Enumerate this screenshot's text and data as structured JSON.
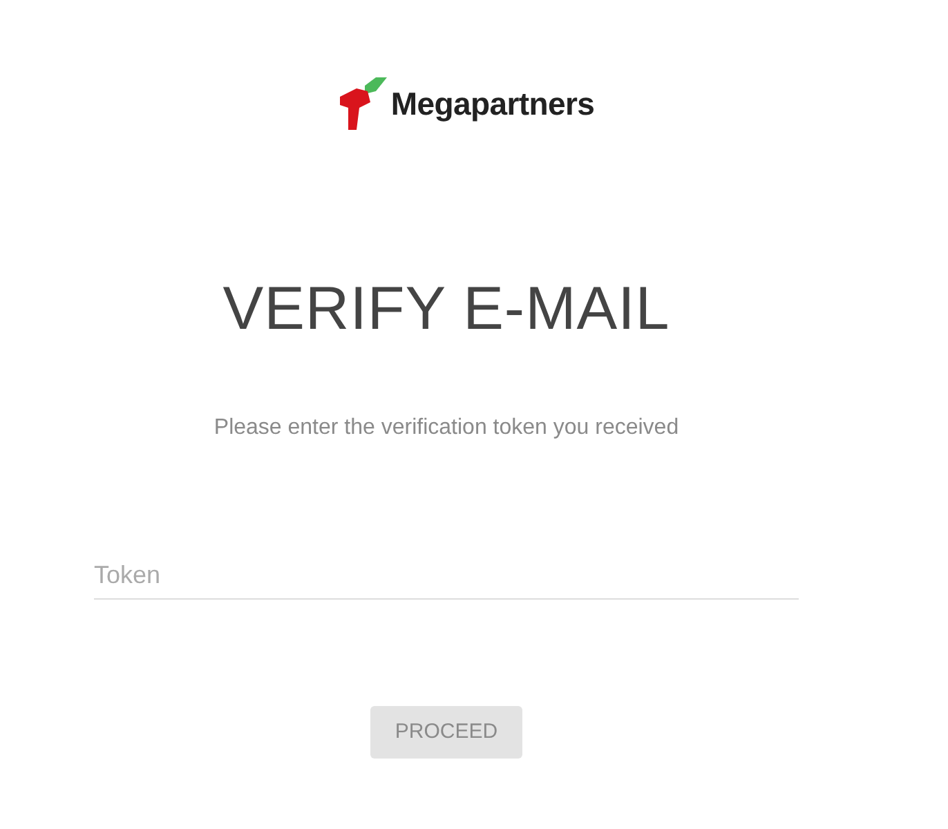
{
  "logo": {
    "text": "Megapartners"
  },
  "heading": "VERIFY E-MAIL",
  "instructions": "Please enter the verification token you received",
  "token_field": {
    "placeholder": "Token"
  },
  "proceed_button": {
    "label": "PROCEED",
    "disabled": true
  }
}
